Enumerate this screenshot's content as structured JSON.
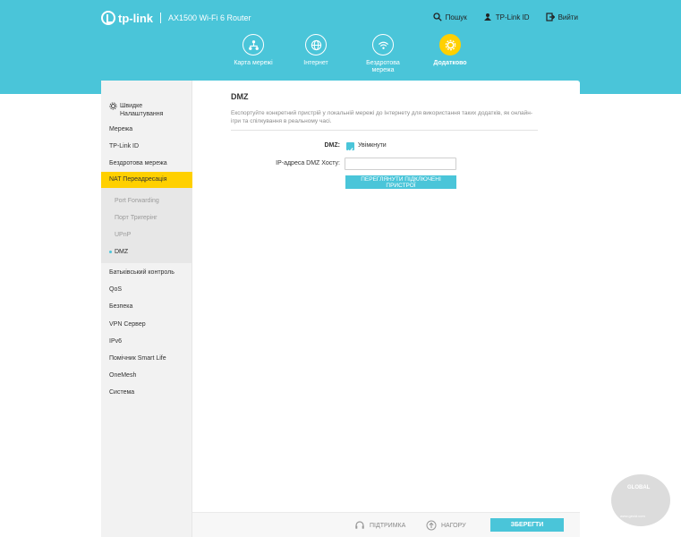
{
  "header": {
    "brand": "tp-link",
    "model": "AX1500 Wi-Fi 6 Router",
    "links": [
      {
        "label": "Пошук",
        "icon": "search-icon"
      },
      {
        "label": "TP-Link ID",
        "icon": "person-icon"
      },
      {
        "label": "Вийти",
        "icon": "logout-icon"
      }
    ]
  },
  "tabs": [
    {
      "label": "Карта мережі",
      "icon": "network-map-icon"
    },
    {
      "label": "Інтернет",
      "icon": "globe-icon"
    },
    {
      "label": "Бездротова мережа",
      "icon": "wifi-icon"
    },
    {
      "label": "Додатково",
      "icon": "gear-icon",
      "active": true
    }
  ],
  "sidebar": {
    "quick_setup": "Швидке Налаштування",
    "items": [
      "Мережа",
      "TP-Link ID",
      "Бездротова мережа",
      "NAT Переадресація"
    ],
    "sub_items": [
      "Port Forwarding",
      "Порт Тригерінг",
      "UPnP",
      "DMZ"
    ],
    "items_after": [
      "Батьківський контроль",
      "QoS",
      "Безпека",
      "VPN Сервер",
      "IPv6",
      "Помічник Smart Life",
      "OneMesh",
      "Система"
    ]
  },
  "main": {
    "title": "DMZ",
    "description": "Експортуйте конкретний пристрій у локальній мережі до Інтернету для використання таких додатків, як онлайн-ігри та спілкування в реальному часі.",
    "dmz_label": "DMZ:",
    "dmz_enable": "Увімкнути",
    "dmz_checked": true,
    "ip_label": "IP-адреса DMZ Хосту:",
    "ip_value": "",
    "view_button": "ПЕРЕГЛЯНУТИ ПІДКЛЮЧЕНІ ПРИСТРОЇ"
  },
  "footer": {
    "support": "ПІДТРИМКА",
    "top": "НАГОРУ",
    "save": "ЗБЕРЕГТИ"
  },
  "watermark": {
    "text1": "GLOBAL",
    "text2": "www.gecid.com"
  },
  "colors": {
    "accent": "#4ac5d9",
    "active": "#ffd000"
  }
}
